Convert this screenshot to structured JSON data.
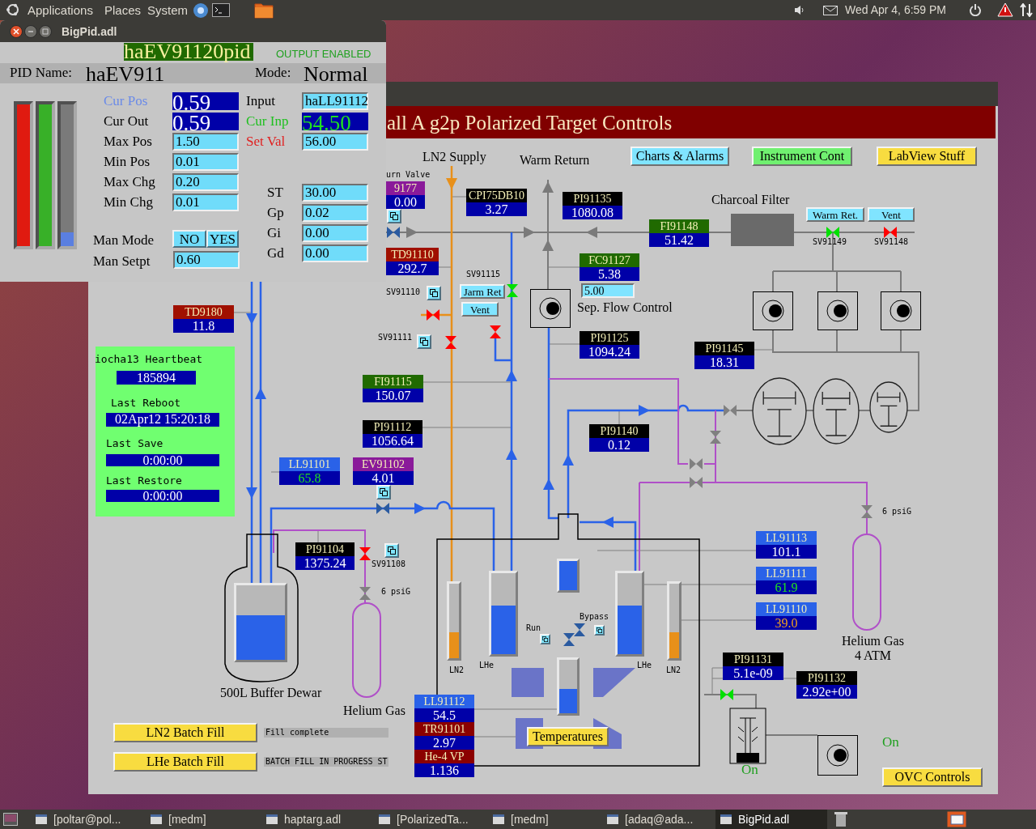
{
  "top_panel": {
    "menus": [
      "Applications",
      "Places",
      "System"
    ],
    "clock": "Wed Apr 4, 6:59 PM"
  },
  "pid_window": {
    "title": "BigPid.adl",
    "record": "haEV91120pid",
    "output_status": "OUTPUT ENABLED",
    "name_label": "PID Name:",
    "name": "haEV911",
    "mode_label": "Mode:",
    "mode": "Normal",
    "bars": [
      {
        "level": 1,
        "color": "#e01a10"
      },
      {
        "level": 1,
        "color": "#38b028"
      },
      {
        "level": 0.1,
        "color": "#5a7fe0"
      }
    ],
    "left_fields": [
      {
        "label": "Cur Pos",
        "value": "0.59",
        "kind": "readout",
        "color": "#6a8ae8"
      },
      {
        "label": "Cur Out",
        "value": "0.59",
        "kind": "readout",
        "color": "#000000"
      },
      {
        "label": "Max Pos",
        "value": "1.50",
        "kind": "entry",
        "color": "#000000"
      },
      {
        "label": "Min Pos",
        "value": "0.01",
        "kind": "entry",
        "color": "#000000"
      },
      {
        "label": "Max Chg",
        "value": "0.20",
        "kind": "entry",
        "color": "#000000"
      },
      {
        "label": "Min Chg",
        "value": "0.01",
        "kind": "entry",
        "color": "#000000"
      }
    ],
    "right_fields": [
      {
        "label": "Input",
        "value": "haLL91112",
        "kind": "entry",
        "color": "#000000"
      },
      {
        "label": "Cur Inp",
        "value": "54.50",
        "kind": "readout",
        "color": "#20c020",
        "alarm_sensitive": true
      },
      {
        "label": "Set Val",
        "value": "56.00",
        "kind": "entry",
        "color": "#e02020"
      },
      {
        "label": "ST",
        "value": "30.00",
        "kind": "entry",
        "color": "#000000"
      },
      {
        "label": "Gp",
        "value": "0.02",
        "kind": "entry",
        "color": "#000000"
      },
      {
        "label": "Gi",
        "value": "0.00",
        "kind": "entry",
        "color": "#000000"
      },
      {
        "label": "Gd",
        "value": "0.00",
        "kind": "entry",
        "color": "#000000"
      }
    ],
    "man_mode": {
      "label": "Man Mode",
      "options": [
        "NO",
        "YES"
      ]
    },
    "man_setpoint": {
      "label": "Man Setpt",
      "value": "0.60"
    }
  },
  "main_window": {
    "title": "all A g2p Polarized Target Controls",
    "nav_buttons": [
      {
        "label": "Charts & Alarms",
        "color": "#80e4ff"
      },
      {
        "label": "Instrument Cont",
        "color": "#70f070"
      },
      {
        "label": "LabView Stuff",
        "color": "#f8dc40"
      }
    ],
    "labels": [
      {
        "text": "urn Valve",
        "kind": "note"
      },
      {
        "text": "LN2 Supply",
        "kind": "caption"
      },
      {
        "text": "Warm Return",
        "kind": "caption"
      },
      {
        "text": "Charcoal Filter",
        "kind": "caption"
      },
      {
        "text": "Sep. Flow Control",
        "kind": "caption"
      },
      {
        "text": "500L Buffer Dewar",
        "kind": "caption"
      },
      {
        "text": "Helium Gas",
        "kind": "caption"
      },
      {
        "text": "Helium Gas",
        "kind": "caption"
      },
      {
        "text": "4 ATM",
        "kind": "caption"
      },
      {
        "text": "6 psiG",
        "kind": "note"
      },
      {
        "text": "6 psiG",
        "kind": "note"
      },
      {
        "text": "LN2",
        "kind": "note"
      },
      {
        "text": "LHe",
        "kind": "note"
      },
      {
        "text": "LHe",
        "kind": "note"
      },
      {
        "text": "LN2",
        "kind": "note"
      },
      {
        "text": "Run",
        "kind": "note"
      },
      {
        "text": "Bypass",
        "kind": "note"
      }
    ],
    "valve_tags": [
      "SV91115",
      "SV91110",
      "SV91111",
      "SV91149",
      "SV91148",
      "SV91108"
    ],
    "readouts": [
      {
        "label": "9177",
        "value": "0.00",
        "color": "#8a1a9a"
      },
      {
        "label": "CPI75DB10",
        "value": "3.27",
        "color": "#000000"
      },
      {
        "label": "PI91135",
        "value": "1080.08",
        "color": "#000000"
      },
      {
        "label": "FI91148",
        "value": "51.42",
        "color": "#206a00"
      },
      {
        "label": "TD91110",
        "value": "292.7",
        "color": "#a01000"
      },
      {
        "label": "FC91127",
        "value": "5.38",
        "color": "#206a00"
      },
      {
        "label": "PI91125",
        "value": "1094.24",
        "color": "#000000"
      },
      {
        "label": "PI91145",
        "value": "18.31",
        "color": "#000000"
      },
      {
        "label": "TD9180",
        "value": "11.8",
        "color": "#a01000"
      },
      {
        "label": "FI91115",
        "value": "150.07",
        "color": "#206a00"
      },
      {
        "label": "PI91112",
        "value": "1056.64",
        "color": "#000000"
      },
      {
        "label": "PI91140",
        "value": "0.12",
        "color": "#000000"
      },
      {
        "label": "LL91101",
        "value": "65.8",
        "color": "#2a62e8",
        "alarm_sensitive": true,
        "minor_alarm": false
      },
      {
        "label": "EV91102",
        "value": "4.01",
        "color": "#8a1a9a"
      },
      {
        "label": "PI91104",
        "value": "1375.24",
        "color": "#000000"
      },
      {
        "label": "LL91113",
        "value": "101.1",
        "color": "#2a62e8"
      },
      {
        "label": "LL91111",
        "value": "61.9",
        "color": "#2a62e8",
        "alarm_sensitive": true,
        "minor_alarm": false
      },
      {
        "label": "LL91110",
        "value": "39.0",
        "color": "#2a62e8",
        "alarm_sensitive": true,
        "minor_alarm": true
      },
      {
        "label": "PI91131",
        "value": "5.1e-09",
        "color": "#000000"
      },
      {
        "label": "PI91132",
        "value": "2.92e+00",
        "color": "#000000"
      },
      {
        "label": "LL91112",
        "value": "54.5",
        "color": "#2a62e8"
      },
      {
        "label": "TR91101",
        "value": "2.97",
        "color": "#8b0000"
      },
      {
        "label": "He-4 VP",
        "value": "1.136",
        "color": "#8b0000"
      }
    ],
    "small_buttons": [
      "Warm Ret.",
      "Vent",
      "Jarm Ret",
      "Vent"
    ],
    "flow_setpoint": "5.00",
    "heartbeat": {
      "title": "iocha13 Heartbeat",
      "count": "185894",
      "rows": [
        {
          "label": "Last Reboot",
          "value": "02Apr12 15:20:18"
        },
        {
          "label": "Last Save",
          "value": "0:00:00"
        },
        {
          "label": "Last Restore",
          "value": "0:00:00"
        }
      ]
    },
    "batch_fills": [
      {
        "label": "LN2 Batch Fill",
        "status": "Fill complete"
      },
      {
        "label": "LHe Batch Fill",
        "status": "BATCH FILL IN PROGRESS ST"
      }
    ],
    "temperatures_button": "Temperatures",
    "ovc_button": "OVC Controls",
    "pump_status": [
      "On",
      "On"
    ],
    "valves": [
      {
        "color": "#2a5aa0"
      },
      {
        "color": "#ff0000"
      },
      {
        "color": "#ff0000"
      },
      {
        "color": "#00e000"
      },
      {
        "color": "#ff0000"
      },
      {
        "color": "#00e000"
      },
      {
        "color": "#ff0000"
      },
      {
        "color": "#ff0000"
      },
      {
        "color": "#2a5aa0"
      },
      {
        "color": "#808080"
      },
      {
        "color": "#808080"
      },
      {
        "color": "#808080"
      },
      {
        "color": "#808080"
      },
      {
        "color": "#00e000"
      },
      {
        "color": "#2a5aa0"
      },
      {
        "color": "#2a5aa0"
      },
      {
        "color": "#808080"
      },
      {
        "color": "#808080"
      }
    ],
    "gauges": [
      {
        "level": 0.6
      },
      {
        "level": 0.35
      },
      {
        "level": 0.6
      },
      {
        "level": 1
      },
      {
        "level": 0.45
      },
      {
        "level": 0.6
      },
      {
        "level": 0.35
      }
    ]
  },
  "taskbar": [
    {
      "label": "[poltar@pol...",
      "selected": false
    },
    {
      "label": "[medm]",
      "selected": false
    },
    {
      "label": "haptarg.adl",
      "selected": false
    },
    {
      "label": "[PolarizedTa...",
      "selected": false
    },
    {
      "label": "[medm]",
      "selected": false
    },
    {
      "label": "[adaq@ada...",
      "selected": false
    },
    {
      "label": "BigPid.adl",
      "selected": true
    }
  ]
}
